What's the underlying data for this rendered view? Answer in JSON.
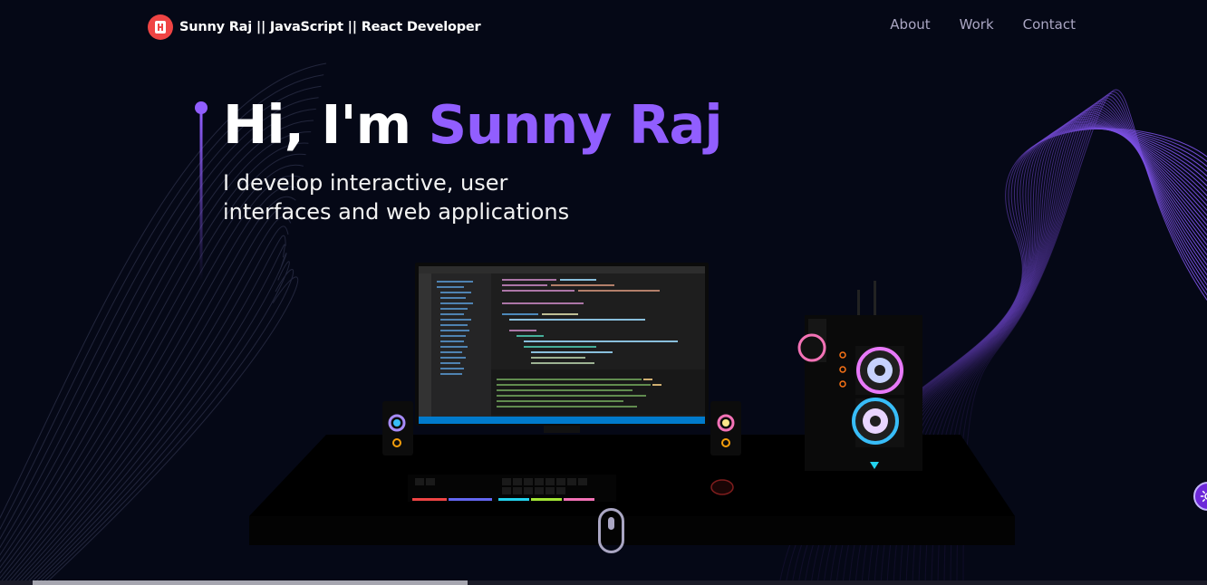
{
  "nav": {
    "brand": "Sunny Raj  || JavaScript || React Developer",
    "links": [
      "About",
      "Work",
      "Contact"
    ]
  },
  "hero": {
    "greeting": "Hi, I'm ",
    "name": "Sunny Raj",
    "subtitle": "I develop interactive, user interfaces and web applications"
  },
  "icons": {
    "logo": "logo-icon",
    "scroll": "mouse-scroll-icon",
    "settings": "gear-icon"
  },
  "colors": {
    "background": "#050816",
    "accent": "#915eff",
    "nav_text": "#aaa6c3",
    "logo": "#ef4444"
  }
}
